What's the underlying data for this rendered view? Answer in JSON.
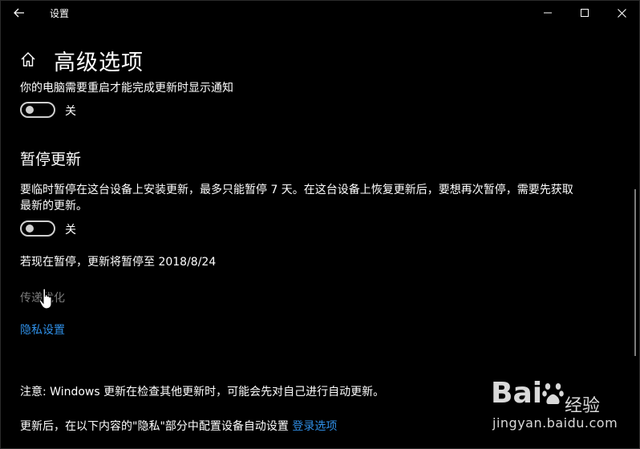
{
  "window": {
    "title": "设置",
    "back_icon": "back-arrow-icon",
    "controls": [
      "minimize-icon",
      "maximize-icon",
      "close-icon"
    ]
  },
  "page": {
    "home_icon": "home-icon",
    "title": "高级选项"
  },
  "restart_notification": {
    "label": "你的电脑需要重启才能完成更新时显示通知",
    "toggle_state": "关",
    "on": false
  },
  "pause_updates": {
    "heading": "暂停更新",
    "description_line1": "要临时暂停在这台设备上安装更新，最多只能暂停 7 天。在这台设备上恢复更新后，要想再次暂停，需要先获取",
    "description_line2": "最新的更新。",
    "toggle_state": "关",
    "on": false,
    "pause_until": "若现在暂停，更新将暂停至 2018/8/24"
  },
  "links": {
    "delivery_optimization": "传递优化",
    "privacy_settings": "隐私设置"
  },
  "footer": {
    "note": "注意: Windows 更新在检查其他更新时，可能会先对自己进行自动更新。",
    "privacy_text": "更新后，在以下内容的\"隐私\"部分中配置设备自动设置",
    "sign_in_options": "登录选项"
  },
  "watermark": {
    "brand": "Bai",
    "brand_tail": "经验",
    "url": "jingyan.baidu.com"
  },
  "colors": {
    "background": "#000000",
    "text": "#ffffff",
    "link": "#2f8fe6",
    "disabled": "#7a7a7a"
  }
}
